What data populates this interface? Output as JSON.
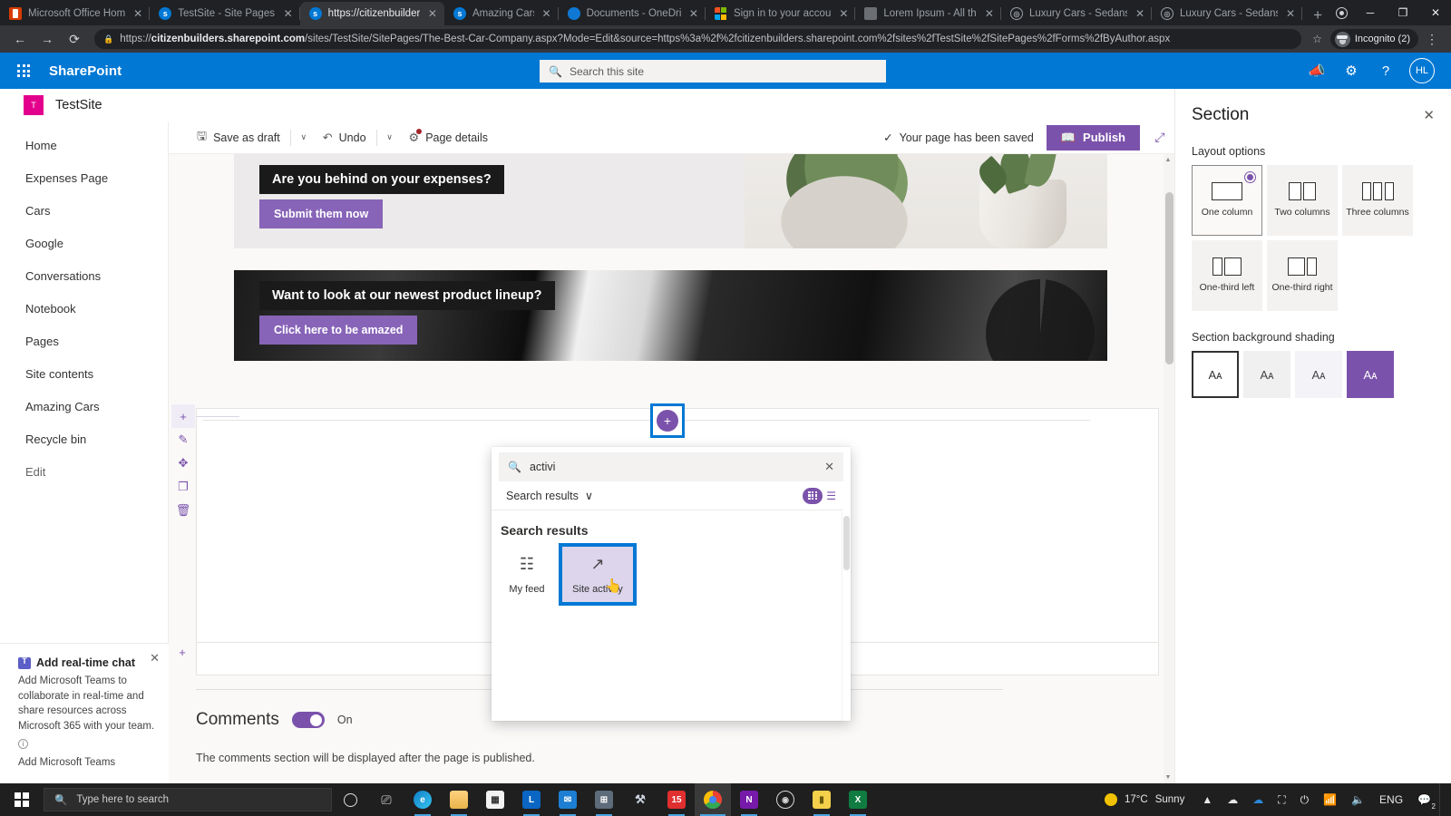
{
  "browser": {
    "tabs": [
      {
        "title": "Microsoft Office Home",
        "favicon": "office-icon",
        "active": false
      },
      {
        "title": "TestSite - Site Pages -",
        "favicon": "sharepoint-icon",
        "active": false
      },
      {
        "title": "https://citizenbuilders",
        "favicon": "sharepoint-icon",
        "active": true
      },
      {
        "title": "Amazing Cars",
        "favicon": "sharepoint-icon",
        "active": false
      },
      {
        "title": "Documents - OneDriv",
        "favicon": "onedrive-icon",
        "active": false
      },
      {
        "title": "Sign in to your accoun",
        "favicon": "microsoft-icon",
        "active": false
      },
      {
        "title": "Lorem Ipsum - All the",
        "favicon": "generic-icon",
        "active": false
      },
      {
        "title": "Luxury Cars - Sedans,",
        "favicon": "mercedes-icon",
        "active": false
      },
      {
        "title": "Luxury Cars - Sedans,",
        "favicon": "mercedes-icon",
        "active": false
      }
    ],
    "new_tab_label": "+",
    "close_label": "✕",
    "window_controls": {
      "minimize": "─",
      "maximize": "❐",
      "close": "✕"
    },
    "nav": {
      "back": "←",
      "forward": "→",
      "reload": "⟳"
    },
    "address": {
      "lock_icon": "lock-icon",
      "prefix": "https://",
      "domain": "citizenbuilders.sharepoint.com",
      "path": "/sites/TestSite/SitePages/The-Best-Car-Company.aspx?Mode=Edit&source=https%3a%2f%2fcitizenbuilders.sharepoint.com%2fsites%2fTestSite%2fSitePages%2fForms%2fByAuthor.aspx"
    },
    "bookmark_icon": "star-icon",
    "incognito_label": "Incognito (2)",
    "menu_icon": "kebab-menu-icon"
  },
  "suite_bar": {
    "waffle_icon": "app-launcher-icon",
    "brand": "SharePoint",
    "search_placeholder": "Search this site",
    "search_icon": "search-icon",
    "icons": [
      "megaphone-icon",
      "gear-icon",
      "help-icon"
    ],
    "avatar_initials": "HL"
  },
  "site": {
    "logo_letter": "T",
    "title": "TestSite"
  },
  "sidebar": {
    "items": [
      {
        "label": "Home"
      },
      {
        "label": "Expenses Page"
      },
      {
        "label": "Cars"
      },
      {
        "label": "Google"
      },
      {
        "label": "Conversations"
      },
      {
        "label": "Notebook"
      },
      {
        "label": "Pages"
      },
      {
        "label": "Site contents"
      },
      {
        "label": "Amazing Cars"
      },
      {
        "label": "Recycle bin"
      },
      {
        "label": "Edit"
      }
    ]
  },
  "teams_promo": {
    "title": "Add real-time chat",
    "body": "Add Microsoft Teams to collaborate in real-time and share resources across Microsoft 365 with your team.",
    "link": "Add Microsoft Teams",
    "close_label": "✕",
    "info_label": "i"
  },
  "command_bar": {
    "save_label": "Save as draft",
    "save_icon": "save-icon",
    "undo_label": "Undo",
    "undo_icon": "undo-icon",
    "page_details_label": "Page details",
    "page_details_icon": "gear-icon",
    "caret": "∨",
    "status_text": "Your page has been saved",
    "status_icon": "checkmark-icon",
    "publish_label": "Publish",
    "publish_icon": "publish-icon",
    "expand_icon": "expand-icon"
  },
  "canvas": {
    "section_rail": [
      {
        "icon": "add-icon",
        "name": "add-section"
      },
      {
        "icon": "edit-icon",
        "name": "edit-section"
      },
      {
        "icon": "move-icon",
        "name": "move-section"
      },
      {
        "icon": "duplicate-icon",
        "name": "duplicate-section"
      },
      {
        "icon": "delete-icon",
        "name": "delete-section"
      }
    ],
    "rail_lower_icon": "add-icon",
    "banners": [
      {
        "caption": "Are you behind on your expenses?",
        "cta": "Submit them now"
      },
      {
        "caption": "Want to look at our newest product lineup?",
        "cta": "Click here to be amazed"
      }
    ],
    "add_webpart_icon": "+",
    "comments": {
      "title": "Comments",
      "toggle_state": "On",
      "note": "The comments section will be displayed after the page is published."
    }
  },
  "picker": {
    "search_icon": "search-icon",
    "query": "activi",
    "clear_icon": "close-icon",
    "filter_label": "Search results",
    "filter_caret": "∨",
    "grid_view_icon": "grid-view-icon",
    "list_view_icon": "list-view-icon",
    "results_heading": "Search results",
    "results": [
      {
        "label": "My feed",
        "icon": "feed-icon",
        "selected": false
      },
      {
        "label": "Site activity",
        "icon": "trending-up-icon",
        "selected": true
      }
    ]
  },
  "pane": {
    "title": "Section",
    "close_label": "✕",
    "layout_label": "Layout options",
    "layouts": [
      {
        "label": "One column",
        "cols": [
          1
        ],
        "selected": true
      },
      {
        "label": "Two columns",
        "cols": [
          1,
          1
        ],
        "selected": false
      },
      {
        "label": "Three columns",
        "cols": [
          1,
          1,
          1
        ],
        "selected": false
      },
      {
        "label": "One-third left",
        "cols": [
          1,
          1.6
        ],
        "selected": false
      },
      {
        "label": "One-third right",
        "cols": [
          1.6,
          1
        ],
        "selected": false
      }
    ],
    "shading_label": "Section background shading",
    "shades": [
      {
        "color": "#ffffff",
        "text_color": "#333333",
        "selected": true
      },
      {
        "color": "#f0f0f0",
        "text_color": "#444444",
        "selected": false
      },
      {
        "color": "#f4f3f8",
        "text_color": "#444444",
        "selected": false
      },
      {
        "color": "#7b52ab",
        "text_color": "#ffffff",
        "selected": false
      }
    ],
    "shade_glyph": "Aᴀ"
  },
  "taskbar": {
    "start_icon": "windows-icon",
    "search_placeholder": "Type here to search",
    "search_icon": "search-icon",
    "cortana_icon": "cortana-icon",
    "taskview_icon": "task-view-icon",
    "apps": [
      {
        "name": "edge-icon",
        "label": "e"
      },
      {
        "name": "file-explorer-icon",
        "label": ""
      },
      {
        "name": "microsoft-store-icon",
        "label": ""
      },
      {
        "name": "linkedin-icon",
        "label": "L"
      },
      {
        "name": "mail-icon",
        "label": ""
      },
      {
        "name": "calculator-icon",
        "label": ""
      },
      {
        "name": "tools-icon",
        "label": ""
      },
      {
        "name": "vlc-icon",
        "label": "15"
      },
      {
        "name": "chrome-icon",
        "label": ""
      },
      {
        "name": "onenote-icon",
        "label": "N"
      },
      {
        "name": "obs-icon",
        "label": ""
      },
      {
        "name": "sticky-notes-icon",
        "label": ""
      },
      {
        "name": "excel-icon",
        "label": "X"
      }
    ],
    "tray": {
      "weather_temp": "17°C",
      "weather_desc": "Sunny",
      "weather_icon": "sun-icon",
      "chevron_icon": "chevron-up-icon",
      "icons": [
        "cloud-icon",
        "onedrive-icon",
        "display-icon",
        "battery-icon",
        "wifi-icon",
        "volume-icon"
      ],
      "language": "ENG",
      "notification_icon": "notification-icon",
      "notification_count": "2"
    }
  }
}
